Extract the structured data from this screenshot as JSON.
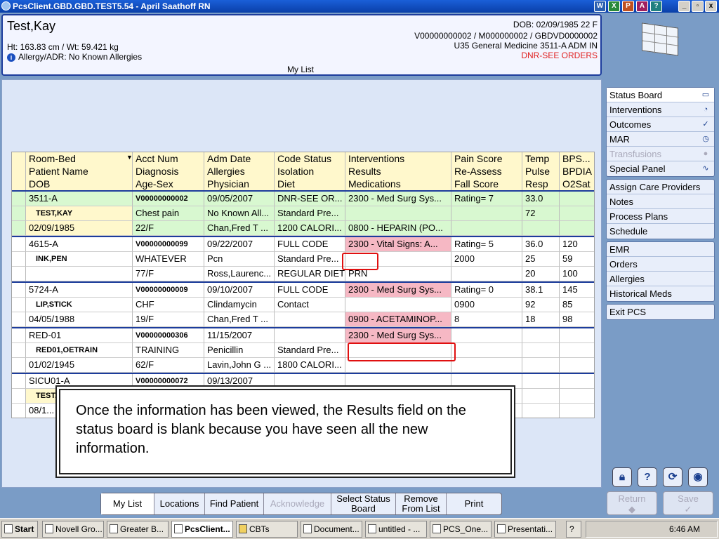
{
  "window": {
    "title": "PcsClient.GBD.GBD.TEST5.54 - April Saathoff RN"
  },
  "header": {
    "name": "Test,Kay",
    "ht_wt": "Ht: 163.83 cm / Wt: 59.421 kg",
    "allergy": "Allergy/ADR: No Known Allergies",
    "dob": "DOB: 02/09/1985 22 F",
    "ids": "V00000000002 / M000000002 / GBDVD0000002",
    "unit": "U35 General Medicine  3511-A  ADM IN",
    "dnr": "DNR-SEE ORDERS",
    "list_label": "My List"
  },
  "grid": {
    "headers": [
      [
        "Room-Bed",
        "Patient Name",
        "DOB"
      ],
      [
        "Acct Num",
        "Diagnosis",
        "Age-Sex"
      ],
      [
        "Adm Date",
        "Allergies",
        "Physician"
      ],
      [
        "Code Status",
        "Isolation",
        "Diet"
      ],
      [
        "Interventions",
        "Results",
        "Medications"
      ],
      [
        "Pain Score",
        "Re-Assess",
        "Fall Score"
      ],
      [
        "Temp",
        "Pulse",
        "Resp"
      ],
      [
        "BPS...",
        "BPDIA",
        "O2Sat"
      ]
    ],
    "patients": [
      {
        "rows": [
          [
            "3511-A",
            "V00000000002",
            "09/05/2007",
            "DNR-SEE OR...",
            "2300 - Med Surg Sys...",
            "Rating= 7",
            "33.0",
            ""
          ],
          [
            "TEST,KAY",
            "Chest pain",
            "No Known All...",
            "Standard Pre...",
            "",
            "",
            "72",
            ""
          ],
          [
            "02/09/1985",
            "22/F",
            "Chan,Fred T ...",
            "1200 CALORI...",
            "0800 - HEPARIN (PO...",
            "",
            "",
            ""
          ]
        ]
      },
      {
        "rows": [
          [
            "4615-A",
            "V00000000099",
            "09/22/2007",
            "FULL CODE",
            "2300 - Vital Signs: A...",
            "Rating= 5",
            "36.0",
            "120"
          ],
          [
            "INK,PEN",
            "WHATEVER",
            "Pcn",
            "Standard Pre...",
            "",
            "2000",
            "25",
            "59"
          ],
          [
            "",
            "77/F",
            "Ross,Laurenc...",
            "REGULAR DIET",
            "PRN",
            "",
            "20",
            "100"
          ]
        ]
      },
      {
        "rows": [
          [
            "5724-A",
            "V00000000009",
            "09/10/2007",
            "FULL CODE",
            "2300 - Med Surg Sys...",
            "Rating= 0",
            "38.1",
            "145"
          ],
          [
            "LIP,STICK",
            "CHF",
            "Clindamycin",
            "Contact",
            "",
            "0900",
            "92",
            "85"
          ],
          [
            "04/05/1988",
            "19/F",
            "Chan,Fred T ...",
            "",
            "0900 - ACETAMINOP...",
            "8",
            "18",
            "98"
          ]
        ]
      },
      {
        "rows": [
          [
            "RED-01",
            "V00000000306",
            "11/15/2007",
            "",
            "2300 - Med Surg Sys...",
            "",
            "",
            ""
          ],
          [
            "RED01,OETRAIN",
            "TRAINING",
            "Penicillin",
            "Standard Pre...",
            "",
            "",
            "",
            ""
          ],
          [
            "01/02/1945",
            "62/F",
            "Lavin,John G ...",
            "1800 CALORI...",
            "",
            "",
            "",
            ""
          ]
        ]
      },
      {
        "rows": [
          [
            "SICU01-A",
            "V00000000072",
            "09/13/2007",
            "",
            "",
            "",
            "",
            ""
          ],
          [
            "TEST...",
            "",
            "",
            "",
            "",
            "",
            "",
            ""
          ],
          [
            "08/1...",
            "",
            "",
            "",
            "",
            "",
            "",
            ""
          ]
        ]
      }
    ]
  },
  "callout": "Once the information has been viewed, the Results field on the status board is blank because you have seen all the new information.",
  "right_panel": {
    "group1": [
      "Status Board",
      "Interventions",
      "Outcomes",
      "MAR",
      "Transfusions",
      "Special Panel"
    ],
    "group2": [
      "Assign Care Providers",
      "Notes",
      "Process Plans",
      "Schedule"
    ],
    "group3": [
      "EMR",
      "Orders",
      "Allergies",
      "Historical Meds"
    ],
    "group4": [
      "Exit PCS"
    ],
    "return": "Return",
    "save": "Save"
  },
  "tabs": [
    "My List",
    "Locations",
    "Find Patient",
    "Acknowledge",
    "Select Status Board",
    "Remove From List",
    "Print"
  ],
  "taskbar": {
    "start": "Start",
    "items": [
      "Novell Gro...",
      "Greater B...",
      "PcsClient...",
      "CBTs",
      "Document...",
      "untitled - ...",
      "PCS_One...",
      "Presentati..."
    ],
    "clock": "6:46 AM"
  }
}
